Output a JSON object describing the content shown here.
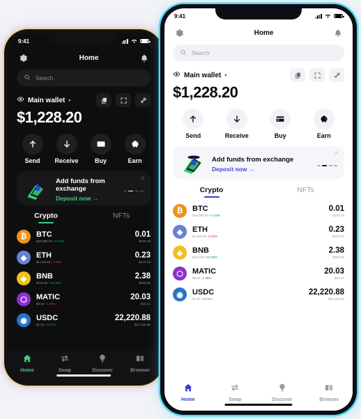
{
  "theme": {
    "dark_accent": "#3ad07a",
    "light_accent": "#2f3fd0",
    "dark_bg": "#0e0e0f",
    "light_bg": "#ffffff",
    "dark_frame": "#121212",
    "light_frame": "#0d0d14"
  },
  "status_bar": {
    "time": "9:41"
  },
  "header": {
    "title": "Home",
    "settings_icon": "gear-icon",
    "notifications_icon": "bell-icon"
  },
  "search": {
    "placeholder": "Search",
    "icon": "search-icon"
  },
  "wallet": {
    "name": "Main wallet",
    "eye_icon": "eye-icon",
    "caret": "▾",
    "balance": "$1,228.20",
    "buttons": [
      {
        "name": "copy-address-button",
        "icon": "copy-icon"
      },
      {
        "name": "scan-qr-button",
        "icon": "scan-icon"
      },
      {
        "name": "connect-button",
        "icon": "link-icon"
      }
    ]
  },
  "actions": [
    {
      "label": "Send",
      "icon": "arrow-up-icon"
    },
    {
      "label": "Receive",
      "icon": "arrow-down-icon"
    },
    {
      "label": "Buy",
      "icon": "card-icon"
    },
    {
      "label": "Earn",
      "icon": "piggy-bank-icon"
    }
  ],
  "promo": {
    "title": "Add funds from exchange",
    "link": "Deposit now",
    "link_arrow": "→",
    "close_icon": "close-icon",
    "art": "phone-deposit-illustration",
    "dots": [
      false,
      true,
      false,
      false
    ]
  },
  "tabs": [
    {
      "label": "Crypto",
      "active": true
    },
    {
      "label": "NFTs",
      "active": false
    }
  ],
  "coins": [
    {
      "symbol": "BTC",
      "glyph": "₿",
      "color": "#f0921f",
      "price": "$26,685.00",
      "change": "+2.43%",
      "change_dir": "pos",
      "amount": "0.01",
      "value": "$226.25"
    },
    {
      "symbol": "ETH",
      "glyph": "◆",
      "color": "#6781d6",
      "price": "$1,628.65",
      "change": "-0.42%",
      "change_dir": "neg",
      "amount": "0.23",
      "value": "$275.33"
    },
    {
      "symbol": "BNB",
      "glyph": "◈",
      "color": "#f0c020",
      "price": "$212.80",
      "change": "+10.38%",
      "change_dir": "pos",
      "amount": "2.38",
      "value": "$506.95"
    },
    {
      "symbol": "MATIC",
      "glyph": "⬡",
      "color": "#8e2fd0",
      "price": "$0.52",
      "change": "-1.36%",
      "change_dir": "neg",
      "amount": "20.03",
      "value": "$16.41"
    },
    {
      "symbol": "USDC",
      "glyph": "◉",
      "color": "#2775ca",
      "price": "$1.00",
      "change": "+0.01%",
      "change_dir": "pos",
      "amount": "22,220.88",
      "value": "$22,220.88"
    }
  ],
  "bottom_nav": [
    {
      "label": "Home",
      "icon": "home-icon",
      "active": true
    },
    {
      "label": "Swap",
      "icon": "swap-icon",
      "active": false
    },
    {
      "label": "Discover",
      "icon": "bulb-icon",
      "active": false
    },
    {
      "label": "Browser",
      "icon": "browser-icon",
      "active": false
    }
  ]
}
